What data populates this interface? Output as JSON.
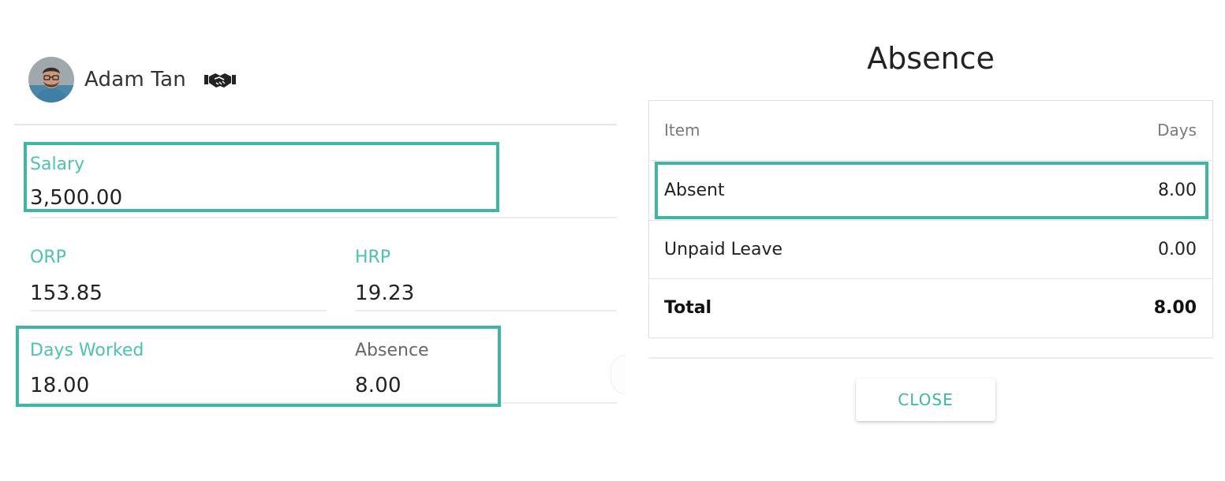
{
  "employee": {
    "name": "Adam Tan",
    "badge_icon": "handshake-icon"
  },
  "fields": {
    "salary": {
      "label": "Salary",
      "value": "3,500.00"
    },
    "orp": {
      "label": "ORP",
      "value": "153.85"
    },
    "hrp": {
      "label": "HRP",
      "value": "19.23"
    },
    "days_worked": {
      "label": "Days Worked",
      "value": "18.00"
    },
    "absence": {
      "label": "Absence",
      "value": "8.00"
    }
  },
  "dialog": {
    "title": "Absence",
    "columns": {
      "item": "Item",
      "days": "Days"
    },
    "rows": [
      {
        "item": "Absent",
        "days": "8.00"
      },
      {
        "item": "Unpaid Leave",
        "days": "0.00"
      }
    ],
    "total": {
      "item": "Total",
      "days": "8.00"
    },
    "close_label": "CLOSE"
  },
  "colors": {
    "accent": "#3db6a6",
    "label_teal": "#4cc3b0"
  }
}
